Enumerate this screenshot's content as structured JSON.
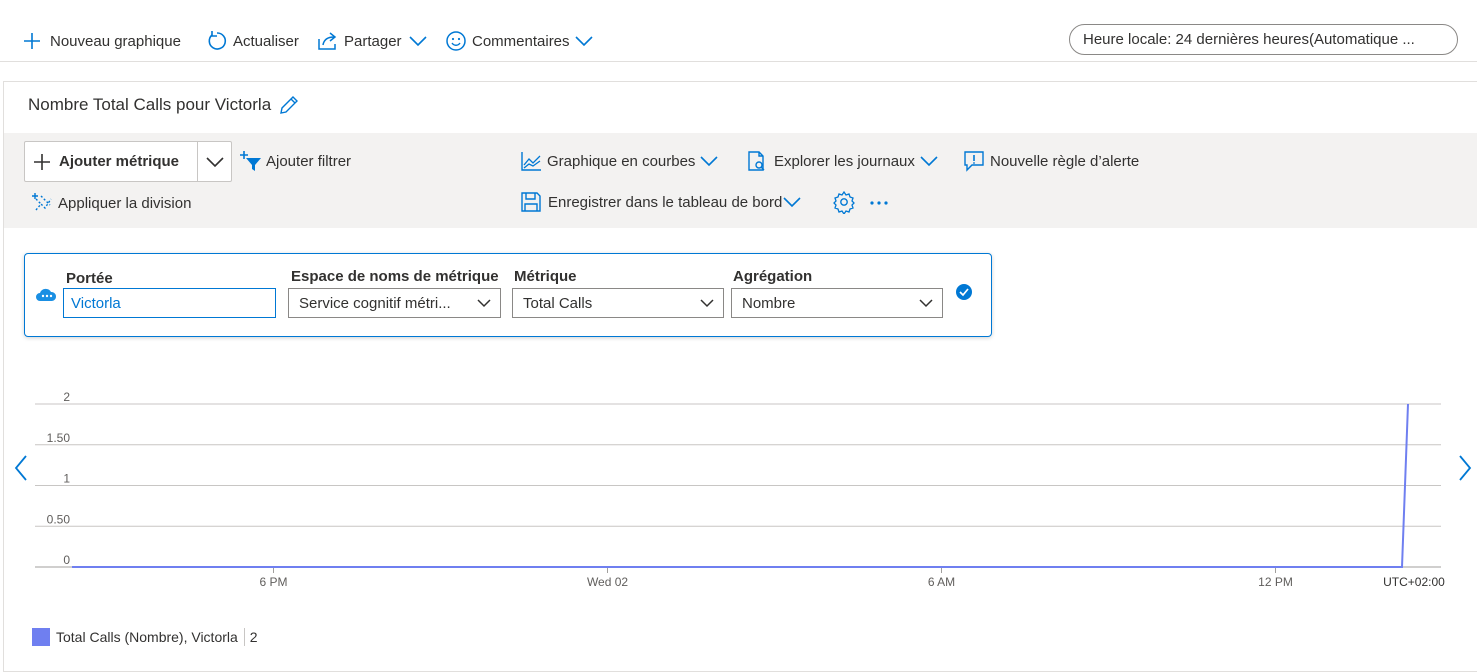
{
  "toolbar_top": {
    "new_chart": "Nouveau graphique",
    "refresh": "Actualiser",
    "share": "Partager",
    "feedback": "Commentaires",
    "time_range": "Heure locale: 24 dernières heures(Automatique ..."
  },
  "chart_title": "Nombre Total Calls pour Victorla",
  "actions": {
    "add_metric": "Ajouter métrique",
    "add_filter": "Ajouter filtrer",
    "apply_split": "Appliquer la division",
    "line_chart": "Graphique en courbes",
    "explore_logs": "Explorer les journaux",
    "new_alert_rule": "Nouvelle règle d’alerte",
    "save_dashboard": "Enregistrer dans le tableau de bord"
  },
  "metric_selector": {
    "scope_label": "Portée",
    "scope_value": "Victorla",
    "namespace_label": "Espace de noms de métrique",
    "namespace_value": "Service cognitif métri...",
    "metric_label": "Métrique",
    "metric_value": "Total Calls",
    "aggregation_label": "Agrégation",
    "aggregation_value": "Nombre"
  },
  "legend": {
    "series_label": "Total Calls (Nombre), Victorla",
    "series_value": "2",
    "color": "#6f7ff0"
  },
  "colors": {
    "accent": "#0078d4",
    "series": "#6f7ff0"
  },
  "chart_data": {
    "type": "line",
    "x_ticks": [
      "6 PM",
      "Wed 02",
      "6 AM",
      "12 PM",
      "UTC+02:00"
    ],
    "y_ticks": [
      "0",
      "0.50",
      "1",
      "1.50",
      "2"
    ],
    "ylim": [
      0,
      2
    ],
    "grid": true,
    "series": [
      {
        "name": "Total Calls (Nombre), Victorla",
        "x_hours": [
          0,
          1,
          2,
          3,
          4,
          5,
          6,
          7,
          8,
          9,
          10,
          11,
          12,
          13,
          14,
          15,
          16,
          17,
          18,
          19,
          20,
          21,
          22,
          23,
          24
        ],
        "values": [
          0,
          0,
          0,
          0,
          0,
          0,
          0,
          0,
          0,
          0,
          0,
          0,
          0,
          0,
          0,
          0,
          0,
          0,
          0,
          0,
          0,
          0,
          0,
          0,
          2
        ]
      }
    ]
  }
}
